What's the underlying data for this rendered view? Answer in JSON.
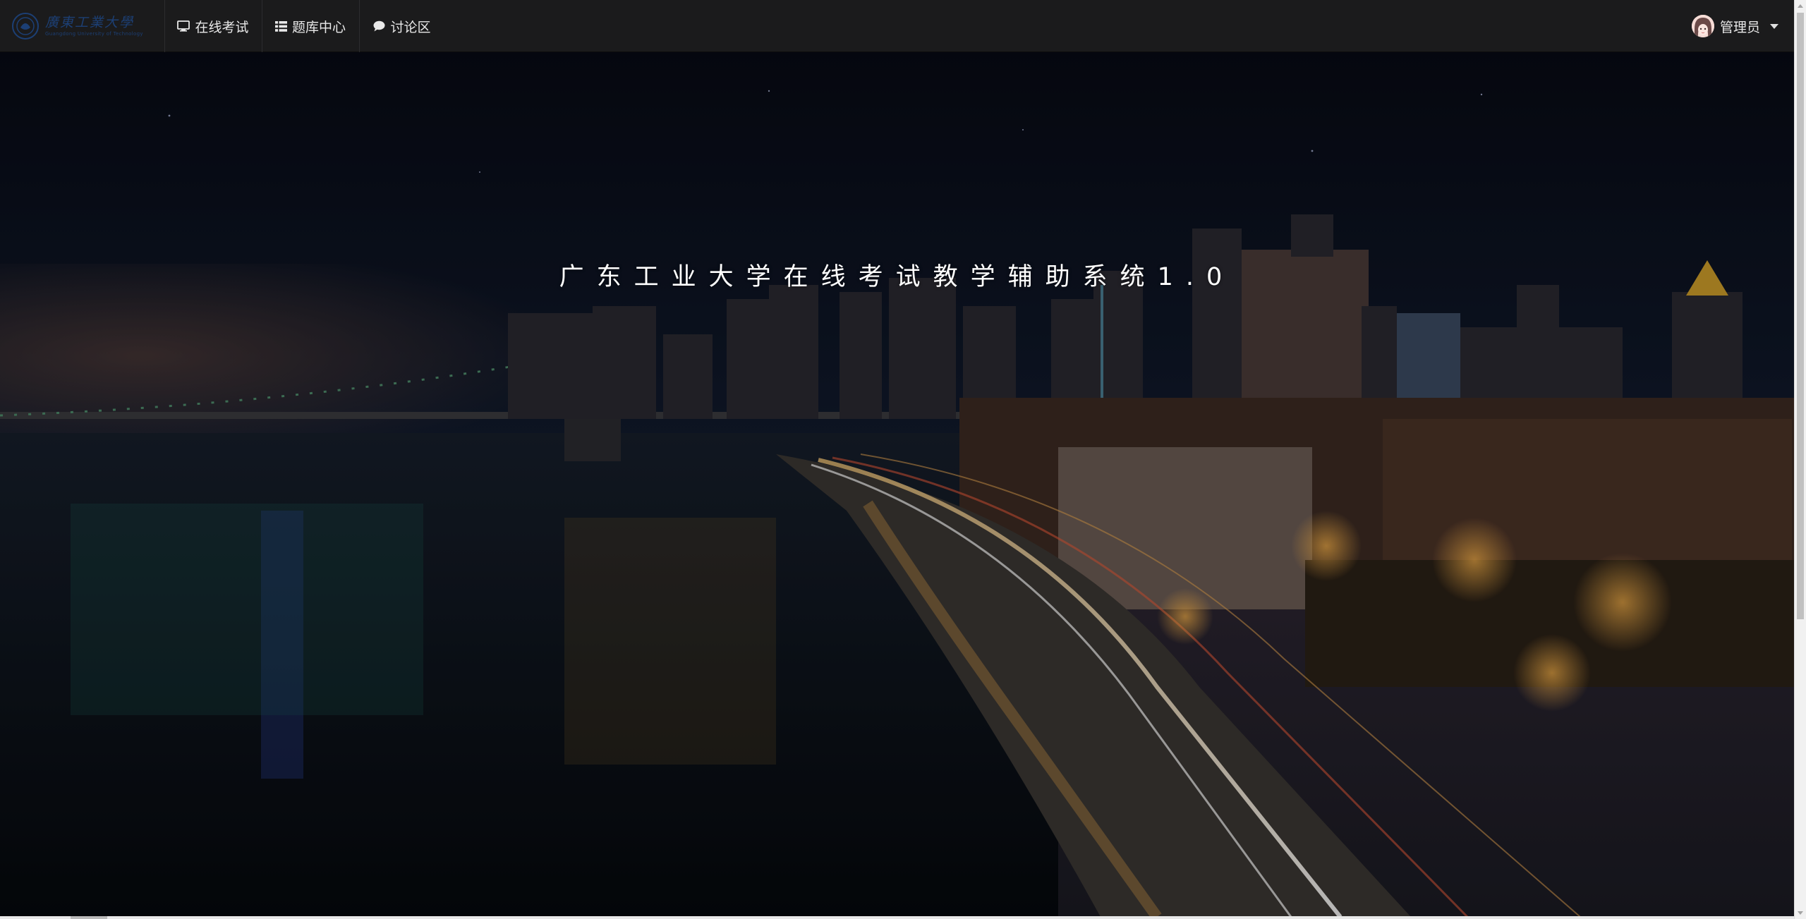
{
  "brand": {
    "name_cn": "廣東工業大學",
    "name_en": "Guangdong University of Technology"
  },
  "nav": {
    "items": [
      {
        "label": "在线考试",
        "icon": "desktop-icon"
      },
      {
        "label": "题库中心",
        "icon": "list-icon"
      },
      {
        "label": "讨论区",
        "icon": "comment-icon"
      }
    ]
  },
  "user": {
    "name": "管理员",
    "avatar_icon": "avatar-icon"
  },
  "hero": {
    "title": "广东工业大学在线考试教学辅助系统1.0",
    "background": "night-city-skyline-image"
  },
  "colors": {
    "navbar_bg": "#1b1b1c",
    "nav_text": "#e9e9e9",
    "brand_blue": "#1c3f74",
    "title_text": "#ffffff"
  }
}
